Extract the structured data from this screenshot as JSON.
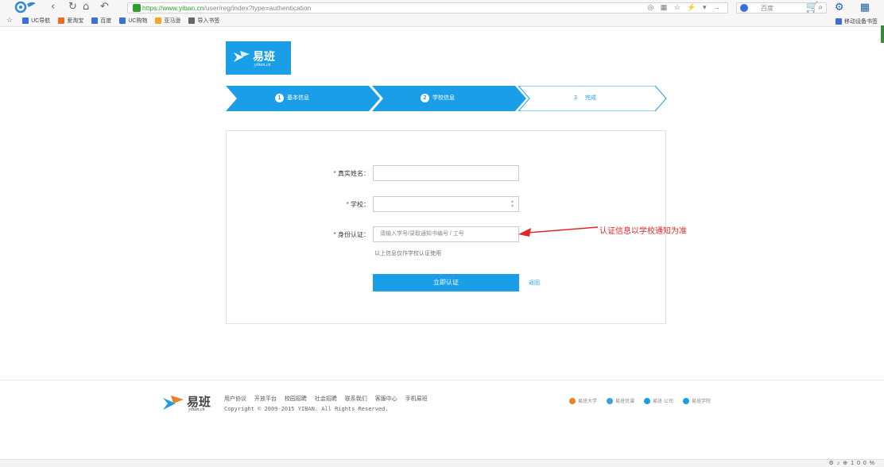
{
  "browser": {
    "url_secure": "https://www.yiban.cn",
    "url_path": "/user/reg/index?type=authentication",
    "search_engine": "百度",
    "bookmarks": [
      {
        "label": "UC导航",
        "color": "#3a6fd8"
      },
      {
        "label": "爱淘宝",
        "color": "#f06a1e"
      },
      {
        "label": "百度",
        "color": "#3b6fd8"
      },
      {
        "label": "UC购物",
        "color": "#3a6fd8"
      },
      {
        "label": "亚马逊",
        "color": "#f5a623"
      },
      {
        "label": "导入书签",
        "color": "#666666"
      }
    ],
    "mobile_bookmarks": "移动设备书签",
    "zoom": "100%"
  },
  "site": {
    "logo_name": "易班",
    "logo_sub": "yiban.cn",
    "brand_color": "#1b9ee8"
  },
  "steps": [
    {
      "num": "1",
      "label": "基本信息",
      "state": "done"
    },
    {
      "num": "2",
      "label": "学校信息",
      "state": "active"
    },
    {
      "num": "3",
      "label": "完成",
      "state": "pending"
    }
  ],
  "form": {
    "real_name_label": "真实姓名：",
    "real_name_value": "",
    "school_label": "学校：",
    "school_value": "",
    "identity_label": "身份认证：",
    "identity_placeholder": "请输入学号/录取通知书编号 / 工号",
    "required_mark": "*",
    "hint": "以上信息仅作学校认证使用",
    "submit_label": "立即认证",
    "back_label": "返回"
  },
  "annotation": {
    "text": "认证信息以学校通知为准",
    "color": "#e2262b"
  },
  "footer": {
    "links": [
      "用户协议",
      "开放平台",
      "校园招聘",
      "社会招聘",
      "联系我们",
      "客服中心",
      "手机易班"
    ],
    "copyright": "Copyright © 2009-2015 YIBAN. All Rights Reserved.",
    "partners": [
      {
        "label": "易班大学",
        "color": "#e8832a"
      },
      {
        "label": "易班优课",
        "color": "#3aa0e0"
      },
      {
        "label": "易班·公司",
        "color": "#1b9ee8"
      },
      {
        "label": "易班学院",
        "color": "#1b9ee8"
      }
    ]
  }
}
